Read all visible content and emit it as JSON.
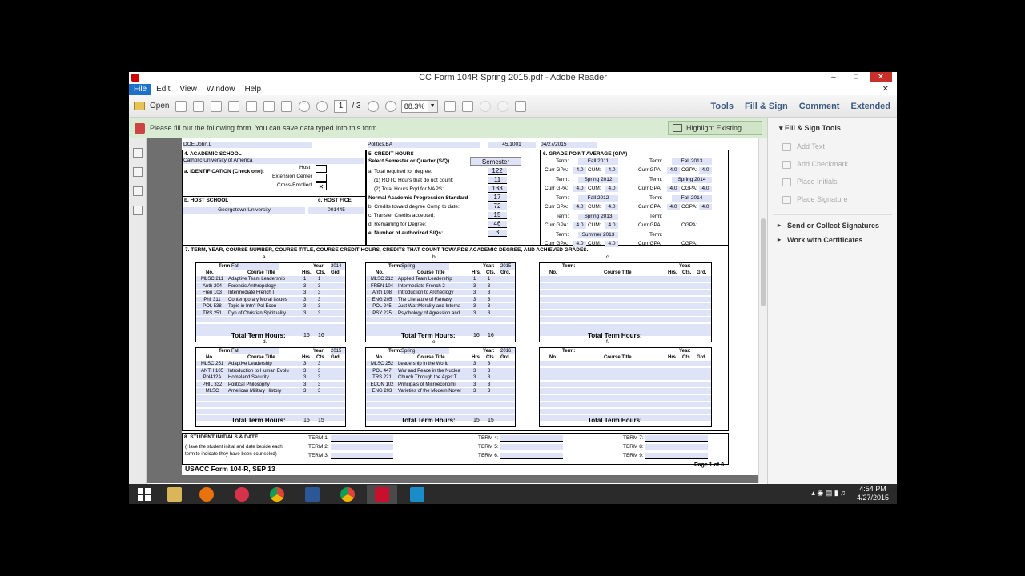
{
  "window": {
    "title": "CC Form 104R Spring 2015.pdf - Adobe Reader",
    "min": "–",
    "max": "□",
    "close": "✕"
  },
  "menu": {
    "items": [
      "File",
      "Edit",
      "View",
      "Window",
      "Help"
    ],
    "close_doc": "✕"
  },
  "toolbar": {
    "open_label": "Open",
    "page_current": "1",
    "page_total": "/ 3",
    "zoom": "88.3%",
    "tools": "Tools",
    "fill_sign": "Fill & Sign",
    "comment": "Comment",
    "extended": "Extended"
  },
  "notice": {
    "text": "Please fill out the following form. You can save data typed into this form.",
    "highlight_button": "Highlight Existing Fields"
  },
  "sidepanel": {
    "header": "Fill & Sign Tools",
    "tools": [
      "Add Text",
      "Add Checkmark",
      "Place Initials",
      "Place Signature"
    ],
    "sections": [
      "Send or Collect Signatures",
      "Work with Certificates"
    ]
  },
  "form": {
    "top": {
      "name_val": "DOE,John,L",
      "major_val": "Politics,BA",
      "code_val": "45.1001",
      "date_val": "04/27/2015"
    },
    "s4": {
      "label": "4. ACADEMIC SCHOOL",
      "school": "Catholic University of America",
      "ident_label": "a. IDENTIFICATION (Check one):",
      "host": "Host",
      "extension": "Extension Center",
      "cross": "Cross-Enrolled",
      "host_school_label": "b. HOST SCHOOL",
      "host_fice_label": "c. HOST FICE",
      "host_school": "Georgetown University",
      "host_fice": "001445"
    },
    "s5": {
      "label": "5. CREDIT HOURS",
      "select_label": "Select Semester or Quarter (S/Q)",
      "select_value": "Semester",
      "rows": [
        {
          "label": "a. Total required for degree:",
          "value": "122"
        },
        {
          "label": "(1) ROTC Hours that do not count:",
          "value": "11"
        },
        {
          "label": "(2) Total Hours Rqd for NAPS:",
          "value": "133"
        },
        {
          "label": "Normal Academic Progression Standard",
          "value": "17"
        },
        {
          "label": "b. Credits toward degree Comp to date:",
          "value": "72"
        },
        {
          "label": "c. Transfer Credits accepted:",
          "value": "15"
        },
        {
          "label": "d. Remaining for Degree:",
          "value": "46"
        },
        {
          "label": "e. Number of authorized S/Qs:",
          "value": "3"
        }
      ]
    },
    "s6": {
      "label": "6. GRADE POINT AVERAGE (GPA)",
      "left": [
        {
          "term": "Fall 2011",
          "curr": "4.0",
          "cum": "4.0"
        },
        {
          "term": "Spring 2012",
          "curr": "4.0",
          "cum": "4.0"
        },
        {
          "term": "Fall 2012",
          "curr": "4.0",
          "cum": "4.0"
        },
        {
          "term": "Spring 2013",
          "curr": "4.0",
          "cum": "4.0"
        },
        {
          "term": "Summer 2013",
          "curr": "4.0",
          "cum": "4.0"
        }
      ],
      "right": [
        {
          "term": "Fall 2013",
          "curr": "4.0",
          "cum": "4.0"
        },
        {
          "term": "Spring 2014",
          "curr": "4.0",
          "cum": "4.0"
        },
        {
          "term": "Fall 2014",
          "curr": "4.0",
          "cum": "4.0"
        },
        {
          "term": "",
          "curr": "",
          "cum": ""
        },
        {
          "term": "",
          "curr": "",
          "cum": ""
        }
      ],
      "term_label": "Term:",
      "curr_label": "Curr GPA:",
      "cum_label": "CUM:",
      "cgpa_label": "CGPA:"
    },
    "s7": {
      "label": "7.   TERM, YEAR, COURSE NUMBER, COURSE TITLE, COURSE CREDIT HOURS, CREDITS THAT COUNT TOWARDS ACADEMIC DEGREE, AND ACHIEVED GRADES.",
      "col_no": "No.",
      "col_title": "Course Title",
      "col_hrs": "Hrs.",
      "col_cts": "Cts.",
      "col_grd": "Grd.",
      "total_label": "Total Term Hours:",
      "term_label": "Term:",
      "year_label": "Year:",
      "terms": [
        {
          "letter": "a.",
          "term": "Fall",
          "year": "2014",
          "total_hrs": "16",
          "total_cts": "16",
          "courses": [
            {
              "no": "MLSC 211",
              "title": "Adaptive Team Leadership",
              "hrs": "1",
              "cts": "1"
            },
            {
              "no": "Anth 204",
              "title": "Forensic Anthropology",
              "hrs": "3",
              "cts": "3"
            },
            {
              "no": "Fren 103",
              "title": "Intermediate French I",
              "hrs": "3",
              "cts": "3"
            },
            {
              "no": "Phil 311",
              "title": "Contemporary Moral Issues",
              "hrs": "3",
              "cts": "3"
            },
            {
              "no": "POL 538",
              "title": "Topic in Intn'l Pol Econ",
              "hrs": "3",
              "cts": "3"
            },
            {
              "no": "TRS 251",
              "title": "Dyn of Christian Spirituality",
              "hrs": "3",
              "cts": "3"
            }
          ]
        },
        {
          "letter": "b.",
          "term": "Spring",
          "year": "2015",
          "total_hrs": "16",
          "total_cts": "16",
          "courses": [
            {
              "no": "MLSC 212",
              "title": "Applied Team Leadership",
              "hrs": "1",
              "cts": "1"
            },
            {
              "no": "FREN 104",
              "title": "Intermediate French 2",
              "hrs": "3",
              "cts": "3"
            },
            {
              "no": "Anth 108",
              "title": "Introduction to Archeology",
              "hrs": "3",
              "cts": "3"
            },
            {
              "no": "ENG 205",
              "title": "The Literature of Fantasy",
              "hrs": "3",
              "cts": "3"
            },
            {
              "no": "POL 245",
              "title": "Just War:Morality and Interna",
              "hrs": "3",
              "cts": "3"
            },
            {
              "no": "PSY 225",
              "title": "Psychology of Agression and",
              "hrs": "3",
              "cts": "3"
            }
          ]
        },
        {
          "letter": "c.",
          "term": "",
          "year": "",
          "total_hrs": "",
          "total_cts": "",
          "courses": []
        },
        {
          "letter": "d.",
          "term": "Fall",
          "year": "2015",
          "total_hrs": "15",
          "total_cts": "15",
          "courses": [
            {
              "no": "MLSC 251",
              "title": "Adaptive Leadership",
              "hrs": "3",
              "cts": "3"
            },
            {
              "no": "ANTH 105",
              "title": "Introduction to Human Evolu",
              "hrs": "3",
              "cts": "3"
            },
            {
              "no": "Pol412A",
              "title": "Homeland Security",
              "hrs": "3",
              "cts": "3"
            },
            {
              "no": "PHIL 332",
              "title": "Political Philosophy",
              "hrs": "3",
              "cts": "3"
            },
            {
              "no": "MLSC",
              "title": "American Military History",
              "hrs": "3",
              "cts": "3"
            }
          ]
        },
        {
          "letter": "e.",
          "term": "Spring",
          "year": "2016",
          "total_hrs": "15",
          "total_cts": "15",
          "courses": [
            {
              "no": "MLSC 252",
              "title": "Leadership in the World",
              "hrs": "3",
              "cts": "3"
            },
            {
              "no": "POL 447",
              "title": "War and Peace in the Nuclea",
              "hrs": "3",
              "cts": "3"
            },
            {
              "no": "TRS 221",
              "title": "Church Through the Ages:T",
              "hrs": "3",
              "cts": "3"
            },
            {
              "no": "ECON 102",
              "title": "Principals of Microeconomi",
              "hrs": "3",
              "cts": "3"
            },
            {
              "no": "ENG 203",
              "title": "Varieties of the Modern Novel",
              "hrs": "3",
              "cts": "3"
            }
          ]
        },
        {
          "letter": "f.",
          "term": "",
          "year": "",
          "total_hrs": "",
          "total_cts": "",
          "courses": []
        }
      ]
    },
    "s8": {
      "label": "8. STUDENT INITIALS & DATE:",
      "note1": "(Have the student initial and date beside each",
      "note2": "term to indicate they have been counseled)",
      "terms": [
        "TERM 1:",
        "TERM 2:",
        "TERM 3:",
        "TERM 4:",
        "TERM 5:",
        "TERM 6:",
        "TERM 7:",
        "TERM 8:",
        "TERM 9:"
      ]
    },
    "form_id": "USACC Form 104-R, SEP 13",
    "page": "Page 1 of 3"
  },
  "taskbar": {
    "time": "4:54 PM",
    "date": "4/27/2015",
    "tray": "▴  ◉  ▤  ▮  ♫"
  }
}
